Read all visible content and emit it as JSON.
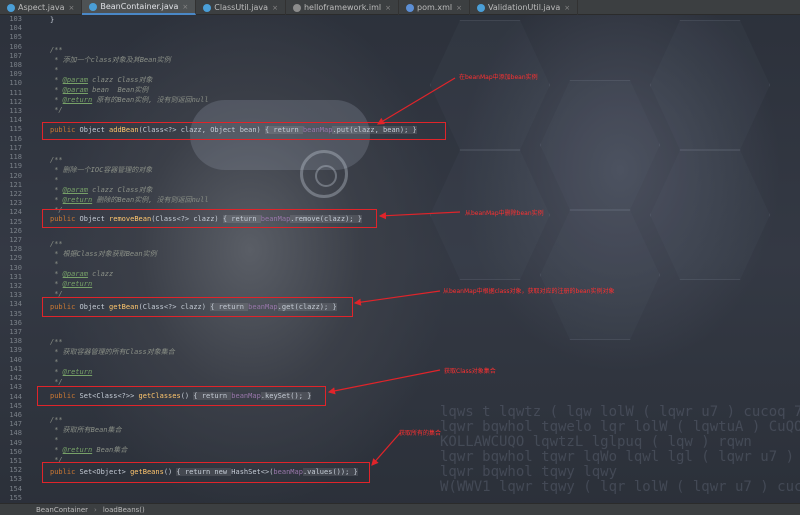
{
  "tabs": [
    {
      "label": "Aspect.java",
      "icon": "java-class-icon",
      "color": "#4a9fd8",
      "active": false
    },
    {
      "label": "BeanContainer.java",
      "icon": "java-class-icon",
      "color": "#4a9fd8",
      "active": true
    },
    {
      "label": "ClassUtil.java",
      "icon": "java-class-icon",
      "color": "#4a9fd8",
      "active": false
    },
    {
      "label": "helloframework.iml",
      "icon": "module-file-icon",
      "color": "#8c8c8c",
      "active": false
    },
    {
      "label": "pom.xml",
      "icon": "maven-icon",
      "color": "#5c8fd6",
      "active": false
    },
    {
      "label": "ValidationUtil.java",
      "icon": "java-class-icon",
      "color": "#4a9fd8",
      "active": false
    }
  ],
  "line_numbers": [
    "103",
    "104",
    "105",
    "106",
    "107",
    "108",
    "109",
    "110",
    "111",
    "112",
    "113",
    "114",
    "115",
    "116",
    "117",
    "118",
    "119",
    "120",
    "121",
    "122",
    "123",
    "124",
    "125",
    "126",
    "127",
    "128",
    "129",
    "130",
    "131",
    "132",
    "133",
    "134",
    "135",
    "136",
    "137",
    "138",
    "139",
    "140",
    "141",
    "142",
    "143",
    "144",
    "145",
    "146",
    "147",
    "148",
    "149",
    "150",
    "151",
    "152",
    "153",
    "154",
    "155"
  ],
  "code": {
    "l103": "}",
    "l106": "/**",
    "l107": " * 添加一个class对象及其Bean实例",
    "l108": " *",
    "l109a": " * ",
    "l109b": "@param",
    "l109c": " clazz Class对象",
    "l110a": " * ",
    "l110b": "@param",
    "l110c": " bean  Bean实例",
    "l111a": " * ",
    "l111b": "@return",
    "l111c": " 原有的Bean实例, 没有则返回null",
    "l112": " */",
    "l113": [
      "public ",
      "Object ",
      "addBean",
      "(Class<?> clazz, Object bean) ",
      "{ return ",
      "beanMap",
      ".put(clazz, bean); }"
    ],
    "l116": "/**",
    "l117": " * 删除一个IOC容器管理的对象",
    "l118": " *",
    "l119a": " * ",
    "l119b": "@param",
    "l119c": " clazz Class对象",
    "l120a": " * ",
    "l120b": "@return",
    "l120c": " 删除的Bean实例, 没有则返回null",
    "l121": " */",
    "l122": [
      "public ",
      "Object ",
      "removeBean",
      "(Class<?> clazz) ",
      "{ return ",
      "beanMap",
      ".remove(clazz); }"
    ],
    "l125": "/**",
    "l126": " * 根据Class对象获取Bean实例",
    "l127": " *",
    "l128a": " * ",
    "l128b": "@param",
    "l128c": " clazz",
    "l129a": " * ",
    "l129b": "@return",
    "l130": " */",
    "l131": [
      "public ",
      "Object ",
      "getBean",
      "(Class<?> clazz) ",
      "{ return ",
      "beanMap",
      ".get(clazz); }"
    ],
    "l134": "/**",
    "l135": " * 获取容器管理的所有Class对象集合",
    "l136": " *",
    "l137a": " * ",
    "l137b": "@return",
    "l138": " */",
    "l139": [
      "public ",
      "Set<Class<?>> ",
      "getClasses",
      "() ",
      "{ return ",
      "beanMap",
      ".keySet(); }"
    ],
    "l142": "/**",
    "l143": " * 获取所有Bean集合",
    "l144": " *",
    "l145a": " * ",
    "l145b": "@return",
    "l145c": " Bean集合",
    "l146": " */",
    "l147": [
      "public ",
      "Set<Object> ",
      "getBeans",
      "() ",
      "{ return new ",
      "HashSet<>(",
      "beanMap",
      ".values()); }"
    ]
  },
  "annotations": [
    "在beanMap中添加bean实例",
    "从beanMap中删除bean实例",
    "从beanMap中根据class对象，获取对应的注册的bean实例对象",
    "获取Class对象集合",
    "获取所有的集合"
  ],
  "breadcrumb": [
    "BeanContainer",
    "loadBeans()"
  ],
  "background_text": "lqws t lqwtz ( lqw lolW ( lqwr u7 ) cucoq 7 CuQOHS\nlqwr bqwhol tqwelo lqr lolW ( lqwtuA ) CuQOHS q\nKOLLAWCUQO lqwtzL lglpuq ( lqw ) rqwn\nlqwr bqwhol tqwr lqWo lqwl lgl ( lqwr u7 ) CuQOHS\nlqwr bqwhol tqwy lqwy\nW(WWV1 lqwr tqwy ( lqr lolW ( lqwr u7 ) cucoq"
}
